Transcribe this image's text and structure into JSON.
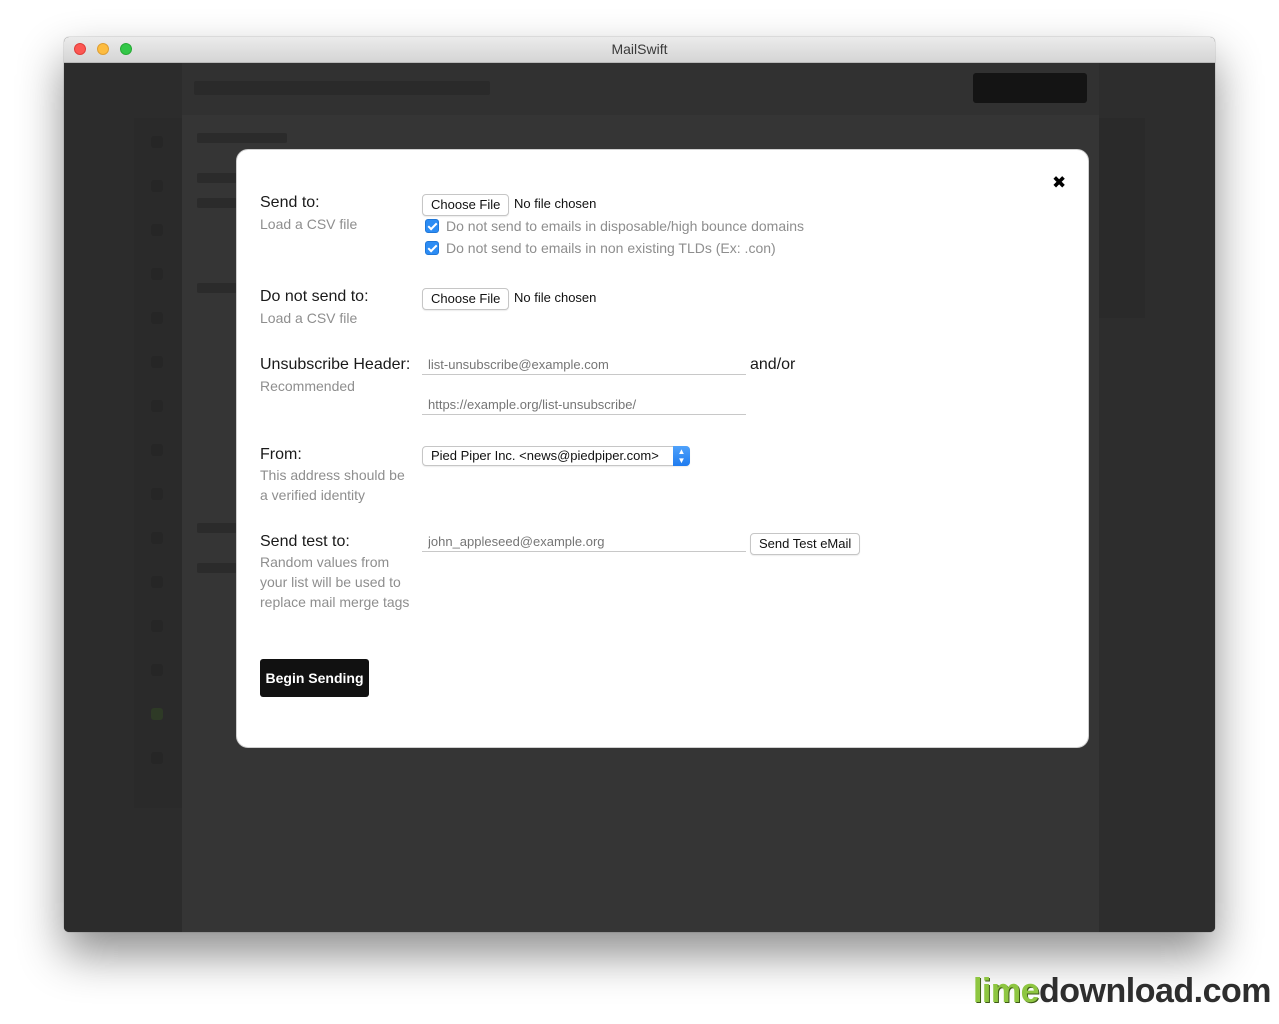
{
  "window": {
    "title": "MailSwift"
  },
  "modal": {
    "close_icon": "close-icon",
    "send_to": {
      "label": "Send to:",
      "hint": "Load a CSV file",
      "file_button": "Choose File",
      "file_status": "No file chosen",
      "options": [
        {
          "label": "Do not send to emails in disposable/high bounce domains",
          "checked": true
        },
        {
          "label": "Do not send to emails in non existing TLDs (Ex: .con)",
          "checked": true
        }
      ]
    },
    "do_not_send_to": {
      "label": "Do not send to:",
      "hint": "Load a CSV file",
      "file_button": "Choose File",
      "file_status": "No file chosen"
    },
    "unsubscribe_header": {
      "label": "Unsubscribe Header:",
      "hint": "Recommended",
      "email_placeholder": "list-unsubscribe@example.com",
      "andor": "and/or",
      "url_placeholder": "https://example.org/list-unsubscribe/"
    },
    "from": {
      "label": "From:",
      "hint_line1": "This address should be",
      "hint_line2": "a verified identity",
      "selected": "Pied Piper Inc. <news@piedpiper.com>"
    },
    "send_test_to": {
      "label": "Send test to:",
      "hint_line1": "Random values from",
      "hint_line2": "your list will be used to",
      "hint_line3": "replace mail merge tags",
      "placeholder": "john_appleseed@example.org",
      "button": "Send Test eMail"
    },
    "begin_button": "Begin Sending"
  },
  "watermark": {
    "part1": "lime",
    "part2": "download.com"
  },
  "colors": {
    "accent": "#2c8cf4",
    "primary_button": "#111111",
    "overlay": "#303030"
  }
}
